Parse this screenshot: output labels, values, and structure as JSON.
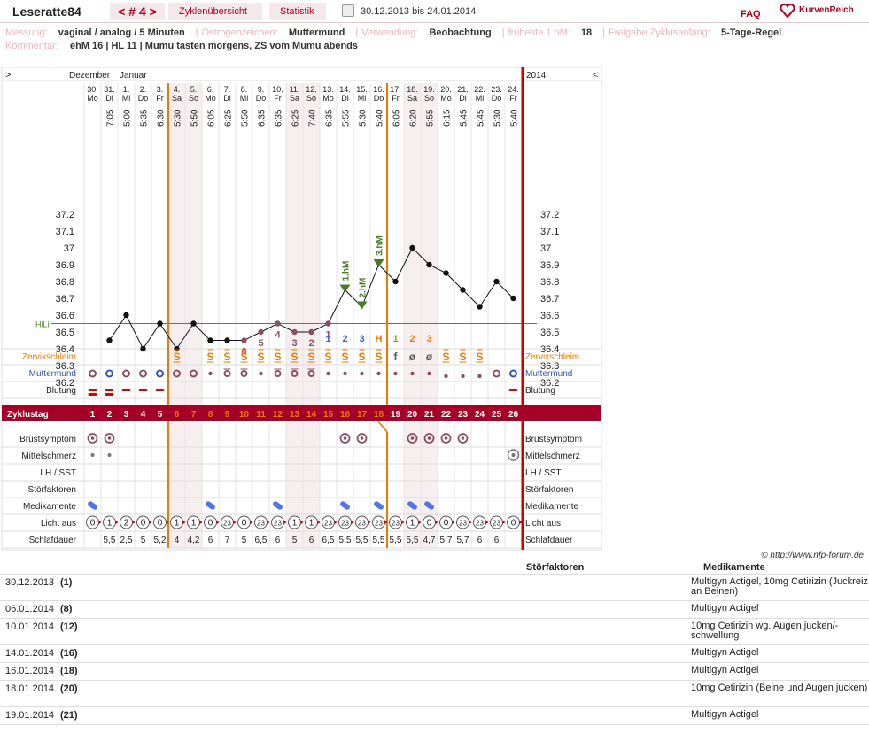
{
  "header": {
    "user": "Leseratte84",
    "cycle": "< # 4 >",
    "tabs": [
      "Zyklenübersicht",
      "Statistik"
    ],
    "daterange": "30.12.2013 bis 24.01.2014",
    "faq": "FAQ",
    "brand": "KurvenReich"
  },
  "info": {
    "line1": [
      [
        "Messung:",
        "vaginal / analog / 5 Minuten"
      ],
      [
        "Östrogenzeichen:",
        "Muttermund"
      ],
      [
        "Verwendung:",
        "Beobachtung"
      ],
      [
        "früheste 1.hM:",
        "18"
      ],
      [
        "Freigabe Zyklusanfang:",
        "5-Tage-Regel"
      ]
    ],
    "line2": [
      "Kommentar:",
      "ehM 16 | HL 11 | Mumu tasten morgens, ZS vom Mumu abends"
    ]
  },
  "chart_data": {
    "type": "line",
    "months": [
      "Dezember",
      "Januar"
    ],
    "year": "2014",
    "nav_left": ">",
    "nav_right": "<",
    "dates": [
      "30.",
      "31.",
      "1.",
      "2.",
      "3.",
      "4.",
      "5.",
      "6.",
      "7.",
      "8.",
      "9.",
      "10.",
      "11.",
      "12.",
      "13.",
      "14.",
      "15.",
      "16.",
      "17.",
      "18.",
      "19.",
      "20.",
      "21.",
      "22.",
      "23.",
      "24."
    ],
    "weekdays": [
      "Mo",
      "Di",
      "Mi",
      "Do",
      "Fr",
      "Sa",
      "So",
      "Mo",
      "Di",
      "Mi",
      "Do",
      "Fr",
      "Sa",
      "So",
      "Mo",
      "Di",
      "Mi",
      "Do",
      "Fr",
      "Sa",
      "So",
      "Mo",
      "Di",
      "Mi",
      "Do",
      "Fr"
    ],
    "times": [
      "",
      "7:05",
      "5:00",
      "5:35",
      "6:30",
      "5:30",
      "5:50",
      "6:05",
      "6:25",
      "5:50",
      "6:35",
      "6:35",
      "6:25",
      "7:40",
      "6:35",
      "5:55",
      "5:30",
      "5:40",
      "6:05",
      "6:20",
      "5:55",
      "6:15",
      "5:45",
      "5:45",
      "5:30",
      "5:40"
    ],
    "temps": [
      null,
      36.45,
      36.6,
      36.4,
      36.55,
      36.4,
      36.55,
      36.45,
      36.45,
      36.45,
      36.5,
      36.55,
      36.5,
      36.5,
      36.55,
      36.75,
      36.65,
      36.9,
      36.8,
      37.0,
      36.9,
      36.85,
      36.75,
      36.65,
      36.8,
      36.7
    ],
    "y_ticks": [
      "37.2",
      "37.1",
      "37",
      "36.9",
      "36.8",
      "36.7",
      "36.6",
      "36.5",
      "36.4",
      "36.3",
      "36.2"
    ],
    "ylim": [
      36.2,
      37.2
    ],
    "hilo_label": "HiLi",
    "hilo": 36.55,
    "low_labels": [
      {
        "day": 10,
        "t": "6"
      },
      {
        "day": 11,
        "t": "5"
      },
      {
        "day": 12,
        "t": "4"
      },
      {
        "day": 13,
        "t": "3"
      },
      {
        "day": 14,
        "t": "2"
      },
      {
        "day": 15,
        "t": "1"
      }
    ],
    "hm_labels": [
      {
        "day": 16,
        "t": "1.hM"
      },
      {
        "day": 17,
        "t": "2.hM"
      },
      {
        "day": 18,
        "t": "3.hM"
      }
    ],
    "peak_numbers": [
      {
        "day": 15,
        "t": "1",
        "c": "#3366cc"
      },
      {
        "day": 16,
        "t": "2",
        "c": "#3366cc"
      },
      {
        "day": 17,
        "t": "3",
        "c": "#3366cc"
      },
      {
        "day": 18,
        "t": "H",
        "c": "#f07800"
      },
      {
        "day": 19,
        "t": "1",
        "c": "#f07800"
      },
      {
        "day": 20,
        "t": "2",
        "c": "#f07800"
      },
      {
        "day": 21,
        "t": "3",
        "c": "#f07800"
      }
    ],
    "cervix_mucus": [
      "",
      "",
      "",
      "",
      "",
      "S",
      "",
      "S",
      "S",
      "S",
      "S",
      "S",
      "S",
      "S",
      "S",
      "S",
      "S",
      "S",
      "f",
      "ø",
      "ø",
      "S",
      "S",
      "S",
      "",
      ""
    ],
    "row_labels": {
      "mucus": "Zervixschleim",
      "mumu": "Muttermund",
      "blood": "Blutung",
      "cycle": "Zyklustag",
      "breast": "Brustsymptom",
      "mittel": "Mittelschmerz",
      "lh": "LH / SST",
      "stoer": "Störfaktoren",
      "medi": "Medikamente",
      "light": "Licht aus",
      "sleep": "Schlafdauer"
    },
    "cycle_days": [
      "1",
      "2",
      "3",
      "4",
      "5",
      "6",
      "7",
      "8",
      "9",
      "10",
      "11",
      "12",
      "13",
      "14",
      "15",
      "16",
      "17",
      "18",
      "19",
      "20",
      "21",
      "22",
      "23",
      "24",
      "25",
      "26"
    ],
    "blood": [
      2,
      2,
      1,
      1,
      1,
      0,
      0,
      0,
      0,
      0,
      0,
      0,
      0,
      0,
      0,
      0,
      0,
      0,
      0,
      0,
      0,
      0,
      0,
      0,
      0,
      1
    ],
    "breast": [
      1,
      1,
      0,
      0,
      0,
      0,
      0,
      0,
      0,
      0,
      0,
      0,
      0,
      0,
      0,
      1,
      1,
      0,
      0,
      1,
      1,
      1,
      1,
      0,
      0,
      0
    ],
    "mittel": [
      1,
      1,
      0,
      0,
      0,
      0,
      0,
      0,
      0,
      0,
      0,
      0,
      0,
      0,
      0,
      0,
      0,
      0,
      0,
      0,
      0,
      0,
      0,
      0,
      0,
      2
    ],
    "medi": [
      1,
      0,
      0,
      0,
      0,
      0,
      0,
      1,
      0,
      0,
      0,
      1,
      0,
      0,
      0,
      1,
      0,
      1,
      0,
      1,
      1,
      0,
      0,
      0,
      0,
      0
    ],
    "light": [
      "0",
      "1",
      "2",
      "0",
      "0",
      "1",
      "1",
      "0",
      "23",
      "0",
      "23",
      "23",
      "1",
      "1",
      "23",
      "23",
      "23",
      "23",
      "23",
      "1",
      "0",
      "0",
      "23",
      "23",
      "23",
      "0"
    ],
    "sleep": [
      "",
      "5,5",
      "2,5",
      "5",
      "5,2",
      "4",
      "4,2",
      "6",
      "7",
      "5",
      "6,5",
      "6",
      "5",
      "6",
      "6,5",
      "5,5",
      "5,5",
      "5,5",
      "5,5",
      "5,5",
      "4,7",
      "5,7",
      "5,7",
      "6",
      "6",
      ""
    ]
  },
  "credit": "© http://www.nfp-forum.de",
  "notes": {
    "headers": [
      "Störfaktoren",
      "Medikamente"
    ],
    "rows": [
      {
        "date": "30.12.2013",
        "cd": "(1)",
        "med": "Multigyn Actigel, 10mg Cetirizin (Juckreiz an Beinen)"
      },
      {
        "date": "06.01.2014",
        "cd": "(8)",
        "med": "Multigyn Actigel"
      },
      {
        "date": "10.01.2014",
        "cd": "(12)",
        "med": "10mg Cetirizin wg. Augen jucken/-schwellung"
      },
      {
        "date": "14.01.2014",
        "cd": "(16)",
        "med": "Multigyn Actigel"
      },
      {
        "date": "16.01.2014",
        "cd": "(18)",
        "med": "Multigyn Actigel"
      },
      {
        "date": "18.01.2014",
        "cd": "(20)",
        "med": "10mg Cetirizin (Beine und Augen jucken)"
      },
      {
        "date": "19.01.2014",
        "cd": "(21)",
        "med": "Multigyn Actigel"
      }
    ]
  }
}
